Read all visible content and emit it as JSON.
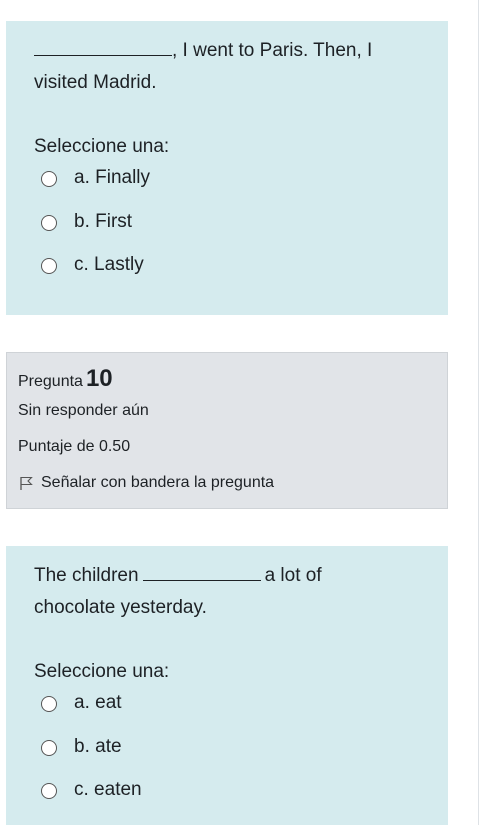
{
  "question9": {
    "text_suffix": ", I went to Paris. Then, I",
    "text_line2": "visited Madrid.",
    "prompt": "Seleccione una:",
    "answers": [
      "a. Finally",
      "b. First",
      "c. Lastly"
    ]
  },
  "question10_info": {
    "label": "Pregunta",
    "number": "10",
    "state": "Sin responder aún",
    "grade": "Puntaje de 0.50",
    "flag_label": "Señalar con bandera la pregunta",
    "flag_icon": "flag-outline-icon"
  },
  "question10": {
    "text_prefix": "The children",
    "text_suffix": "a lot of",
    "text_line2": "chocolate yesterday.",
    "prompt": "Seleccione una:",
    "answers": [
      "a. eat",
      "b. ate",
      "c. eaten"
    ]
  },
  "colors": {
    "question_bg": "#d5ebee",
    "info_bg": "#e1e4e8",
    "text": "#1d2125"
  }
}
